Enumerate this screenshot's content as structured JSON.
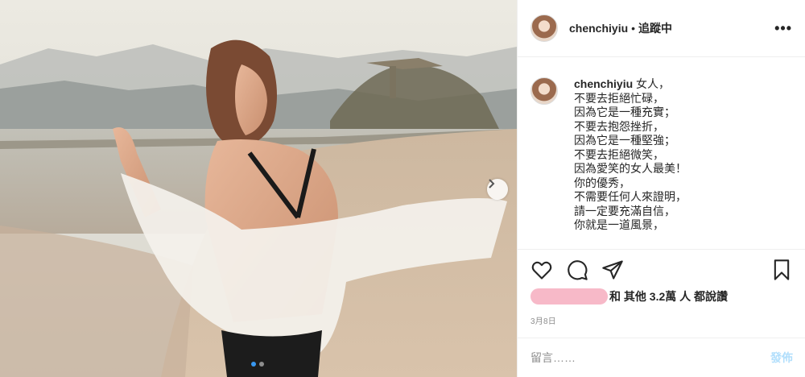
{
  "post": {
    "username": "chenchiyiu",
    "separator": "•",
    "follow_status": "追蹤中",
    "more_icon": "•••"
  },
  "caption": {
    "username": "chenchiyiu",
    "lines": [
      " 女人，",
      "不要去拒絕忙碌，",
      "因為它是一種充實；",
      "不要去抱怨挫折，",
      "因為它是一種堅強；",
      "不要去拒絕微笑，",
      "因為愛笑的女人最美！",
      "你的優秀，",
      "不需要任何人來證明，",
      "請一定要充滿自信，",
      "你就是一道風景，"
    ]
  },
  "icons": {
    "like": "heart-icon",
    "comment": "comment-icon",
    "share": "share-icon",
    "save": "bookmark-icon",
    "next": "chevron-right-icon"
  },
  "likes": {
    "text": "和 其他 3.2萬 人 都說讚"
  },
  "date": "3月8日",
  "comment": {
    "placeholder": "留言……",
    "post_label": "發佈"
  },
  "carousel": {
    "current": 1,
    "total": 2
  },
  "colors": {
    "accent": "#3897f0",
    "post_disabled": "#b2dffc",
    "redaction": "#f7b9c8"
  }
}
